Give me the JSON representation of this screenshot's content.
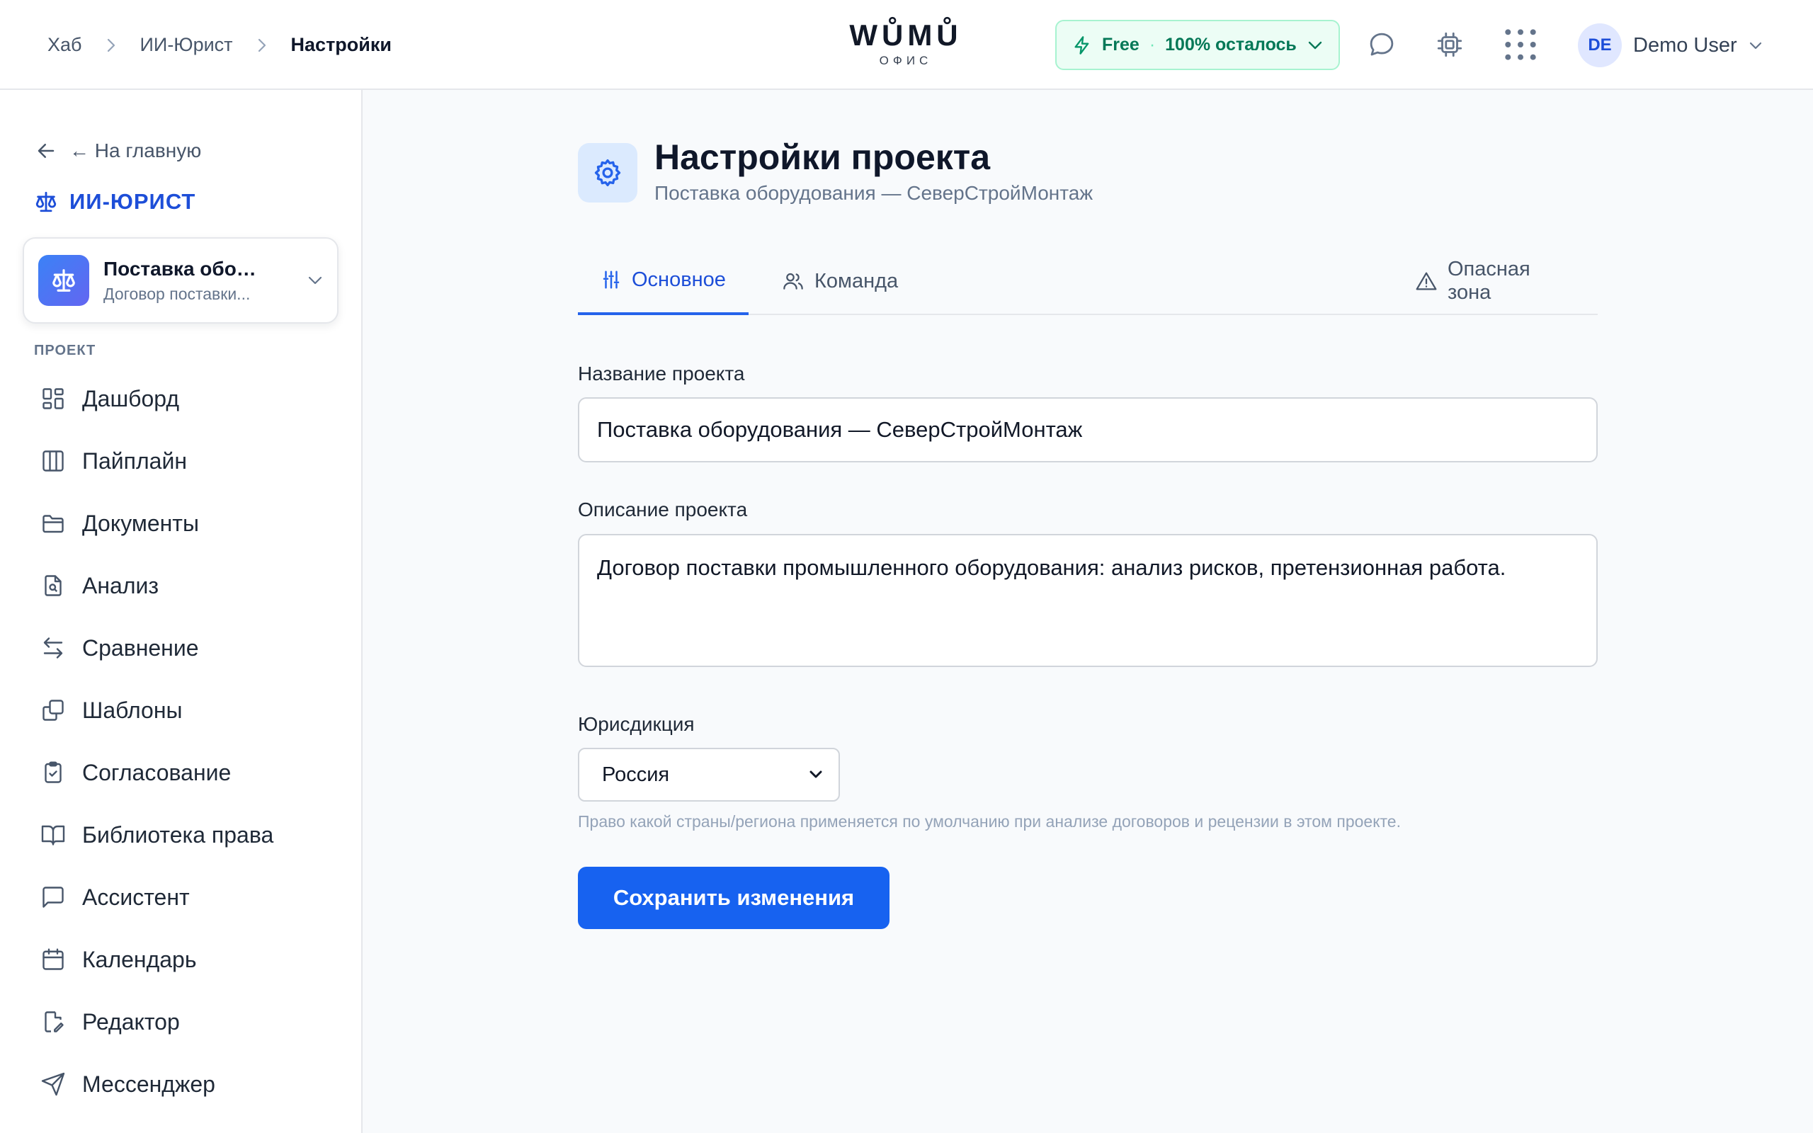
{
  "breadcrumb": {
    "items": [
      "Хаб",
      "ИИ-Юрист"
    ],
    "current": "Настройки"
  },
  "logo": {
    "brand": "WŮMŮ",
    "sub": "ОФИС"
  },
  "plan": {
    "name": "Free",
    "separator": "·",
    "remaining": "100% осталось"
  },
  "user": {
    "initials": "DE",
    "name": "Demo User"
  },
  "sidebar": {
    "back_label": "← На главную",
    "module_title": "ИИ-ЮРИСТ",
    "project": {
      "title": "Поставка обор...",
      "subtitle": "Договор поставки..."
    },
    "section_label": "ПРОЕКТ",
    "items": [
      {
        "label": "Дашборд",
        "icon": "dashboard-icon"
      },
      {
        "label": "Пайплайн",
        "icon": "pipeline-icon"
      },
      {
        "label": "Документы",
        "icon": "folder-icon"
      },
      {
        "label": "Анализ",
        "icon": "file-search-icon"
      },
      {
        "label": "Сравнение",
        "icon": "arrows-compare-icon"
      },
      {
        "label": "Шаблоны",
        "icon": "copy-icon"
      },
      {
        "label": "Согласование",
        "icon": "clipboard-check-icon"
      },
      {
        "label": "Библиотека права",
        "icon": "book-icon"
      },
      {
        "label": "Ассистент",
        "icon": "chat-icon"
      },
      {
        "label": "Календарь",
        "icon": "calendar-icon"
      },
      {
        "label": "Редактор",
        "icon": "file-edit-icon"
      },
      {
        "label": "Мессенджер",
        "icon": "send-icon"
      }
    ]
  },
  "page": {
    "title": "Настройки проекта",
    "subtitle": "Поставка оборудования — СеверСтройМонтаж"
  },
  "tabs": {
    "general": "Основное",
    "team": "Команда",
    "danger": "Опасная зона"
  },
  "form": {
    "name_label": "Название проекта",
    "name_value": "Поставка оборудования — СеверСтройМонтаж",
    "description_label": "Описание проекта",
    "description_value": "Договор поставки промышленного оборудования: анализ рисков, претензионная работа.",
    "jurisdiction_label": "Юрисдикция",
    "jurisdiction_value": "Россия",
    "jurisdiction_hint": "Право какой страны/региона применяется по умолчанию при анализе договоров и рецензии в этом проекте.",
    "save_label": "Сохранить изменения"
  },
  "colors": {
    "accent": "#1762f0",
    "plan_bg": "#ecfdf5",
    "plan_text": "#047857"
  }
}
